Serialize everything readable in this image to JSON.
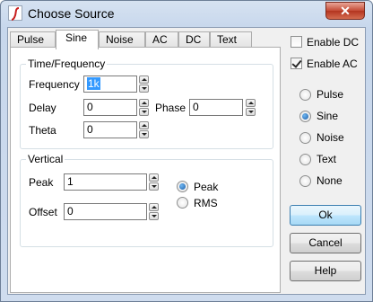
{
  "window": {
    "title": "Choose Source",
    "close_glyph": "✕",
    "app_icon": "ltspice-app-icon"
  },
  "tabs": [
    {
      "label": "Pulse",
      "active": false
    },
    {
      "label": "Sine",
      "active": true
    },
    {
      "label": "Noise",
      "active": false
    },
    {
      "label": "AC",
      "active": false
    },
    {
      "label": "DC",
      "active": false
    },
    {
      "label": "Text",
      "active": false
    }
  ],
  "time_frequency": {
    "title": "Time/Frequency",
    "frequency_label": "Frequency",
    "frequency_value": "1k",
    "delay_label": "Delay",
    "delay_value": "0",
    "phase_label": "Phase",
    "phase_value": "0",
    "theta_label": "Theta",
    "theta_value": "0"
  },
  "vertical": {
    "title": "Vertical",
    "peak_label": "Peak",
    "peak_value": "1",
    "offset_label": "Offset",
    "offset_value": "0",
    "radio_peak": "Peak",
    "radio_rms": "RMS",
    "selected": "Peak"
  },
  "options": {
    "enable_dc_label": "Enable DC",
    "enable_dc": false,
    "enable_ac_label": "Enable AC",
    "enable_ac": true
  },
  "source_type": {
    "items": [
      "Pulse",
      "Sine",
      "Noise",
      "Text",
      "None"
    ],
    "selected": "Sine"
  },
  "buttons": {
    "ok": "Ok",
    "cancel": "Cancel",
    "help": "Help"
  },
  "colors": {
    "accent": "#3399ff",
    "title_bar": "#c7d7ec",
    "close": "#c44a34"
  }
}
